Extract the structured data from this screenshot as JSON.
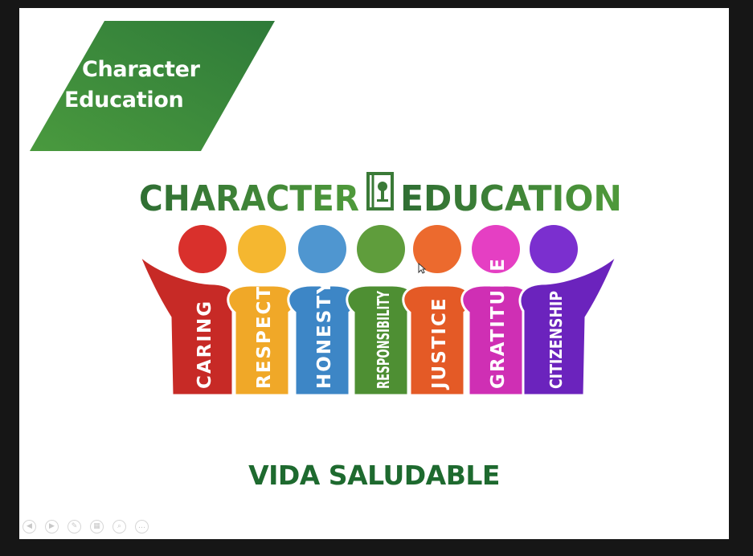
{
  "banner": {
    "line1": "Character",
    "line2": "Education",
    "color_light": "#4a9a3e",
    "color_dark": "#2e7a39"
  },
  "logo": {
    "title_left": "CHARACTER",
    "title_right": "EDUCATION",
    "title_color": "#3a7a37",
    "figures": [
      {
        "word": "CARING",
        "head_color": "#d9302c",
        "body_color": "#c72a26"
      },
      {
        "word": "RESPECT",
        "head_color": "#f5b730",
        "body_color": "#f0a828"
      },
      {
        "word": "HONESTY",
        "head_color": "#4f96d0",
        "body_color": "#3d86c6"
      },
      {
        "word": "RESPONSIBILITY",
        "head_color": "#5f9d3c",
        "body_color": "#4e8f33"
      },
      {
        "word": "JUSTICE",
        "head_color": "#ec6a2e",
        "body_color": "#e45a26"
      },
      {
        "word": "GRATITUDE",
        "head_color": "#e53fc3",
        "body_color": "#cf2fb4"
      },
      {
        "word": "CITIZENSHIP",
        "head_color": "#7b2fcf",
        "body_color": "#6b23bd"
      }
    ]
  },
  "subtitle": "VIDA SALUDABLE",
  "controls": [
    {
      "name": "previous-slide-button",
      "icon": "arrow-left-icon",
      "glyph": "◀"
    },
    {
      "name": "next-slide-button",
      "icon": "arrow-right-icon",
      "glyph": "▶"
    },
    {
      "name": "pen-tool-button",
      "icon": "pen-icon",
      "glyph": "✎"
    },
    {
      "name": "slides-grid-button",
      "icon": "grid-icon",
      "glyph": "▦"
    },
    {
      "name": "zoom-button",
      "icon": "magnifier-icon",
      "glyph": "⌕"
    },
    {
      "name": "more-options-button",
      "icon": "ellipsis-icon",
      "glyph": "…"
    }
  ]
}
